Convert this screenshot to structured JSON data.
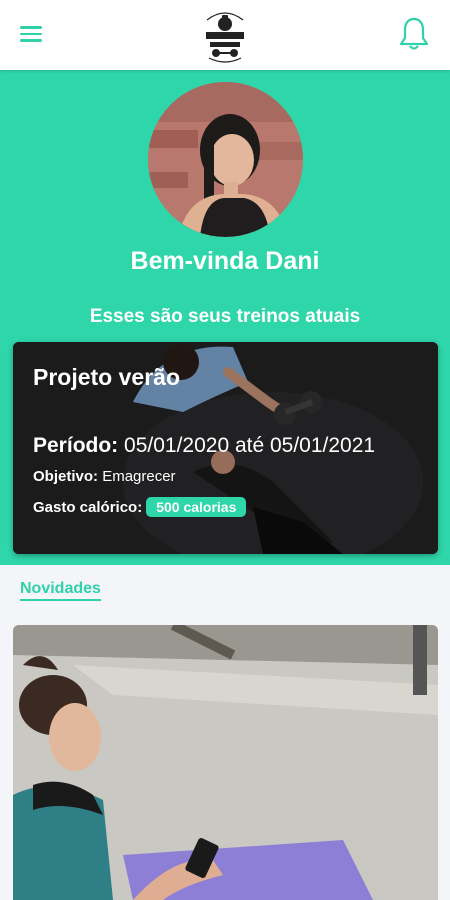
{
  "header": {
    "menu_icon": "menu-icon",
    "logo_icon": "gym-logo-icon",
    "notification_icon": "bell-icon",
    "accent": "#2fd1a8"
  },
  "hero": {
    "background": "#2fd6aa",
    "welcome": "Bem-vinda Dani",
    "subtitle": "Esses são seus treinos atuais"
  },
  "workout": {
    "title": "Projeto verão",
    "period_label": "Período:",
    "period_value": "05/01/2020 até 05/01/2021",
    "objective_label": "Objetivo:",
    "objective_value": "Emagrecer",
    "calories_label": "Gasto calórico:",
    "calories_value": "500 calorias"
  },
  "news": {
    "label": "Novidades"
  }
}
